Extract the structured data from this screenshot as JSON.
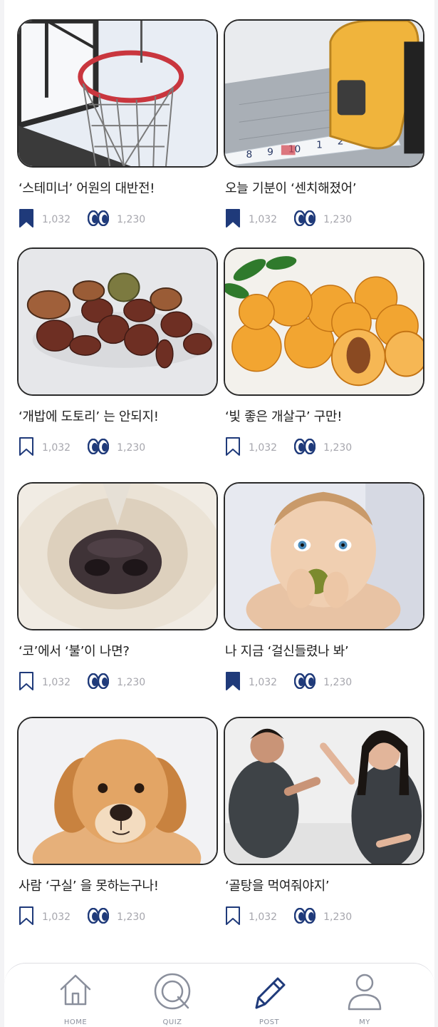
{
  "colors": {
    "accent": "#1f3a7a",
    "muted": "#a6a6ad",
    "nav_icon": "#8a8f9c"
  },
  "cards": [
    {
      "title": "‘스테미너’ 어원의 대반전!",
      "saves": "1,032",
      "views": "1,230",
      "bookmarked": true,
      "image": "basketball-hoop"
    },
    {
      "title": "오늘 기분이 ‘센치해졌어’",
      "saves": "1,032",
      "views": "1,230",
      "bookmarked": true,
      "image": "tape-measure"
    },
    {
      "title": "‘개밥에 도토리’ 는 안되지!",
      "saves": "1,032",
      "views": "1,230",
      "bookmarked": false,
      "image": "chestnuts"
    },
    {
      "title": "‘빛 좋은 개살구’ 구만!",
      "saves": "1,032",
      "views": "1,230",
      "bookmarked": false,
      "image": "apricots"
    },
    {
      "title": "‘코’에서 ‘불’이 나면?",
      "saves": "1,032",
      "views": "1,230",
      "bookmarked": false,
      "image": "dog-nose"
    },
    {
      "title": "나 지금 ‘걸신들렸나 봐’",
      "saves": "1,032",
      "views": "1,230",
      "bookmarked": true,
      "image": "baby-eating"
    },
    {
      "title": "사람 ‘구실’ 을 못하는구나!",
      "saves": "1,032",
      "views": "1,230",
      "bookmarked": false,
      "image": "puppy"
    },
    {
      "title": "‘골탕을 먹여줘야지’",
      "saves": "1,032",
      "views": "1,230",
      "bookmarked": false,
      "image": "couple-arguing"
    }
  ],
  "nav": [
    {
      "label": "HOME",
      "icon": "home-icon",
      "active": false
    },
    {
      "label": "QUIZ",
      "icon": "quiz-icon",
      "active": false
    },
    {
      "label": "POST",
      "icon": "pencil-icon",
      "active": true
    },
    {
      "label": "MY",
      "icon": "user-icon",
      "active": false
    }
  ]
}
